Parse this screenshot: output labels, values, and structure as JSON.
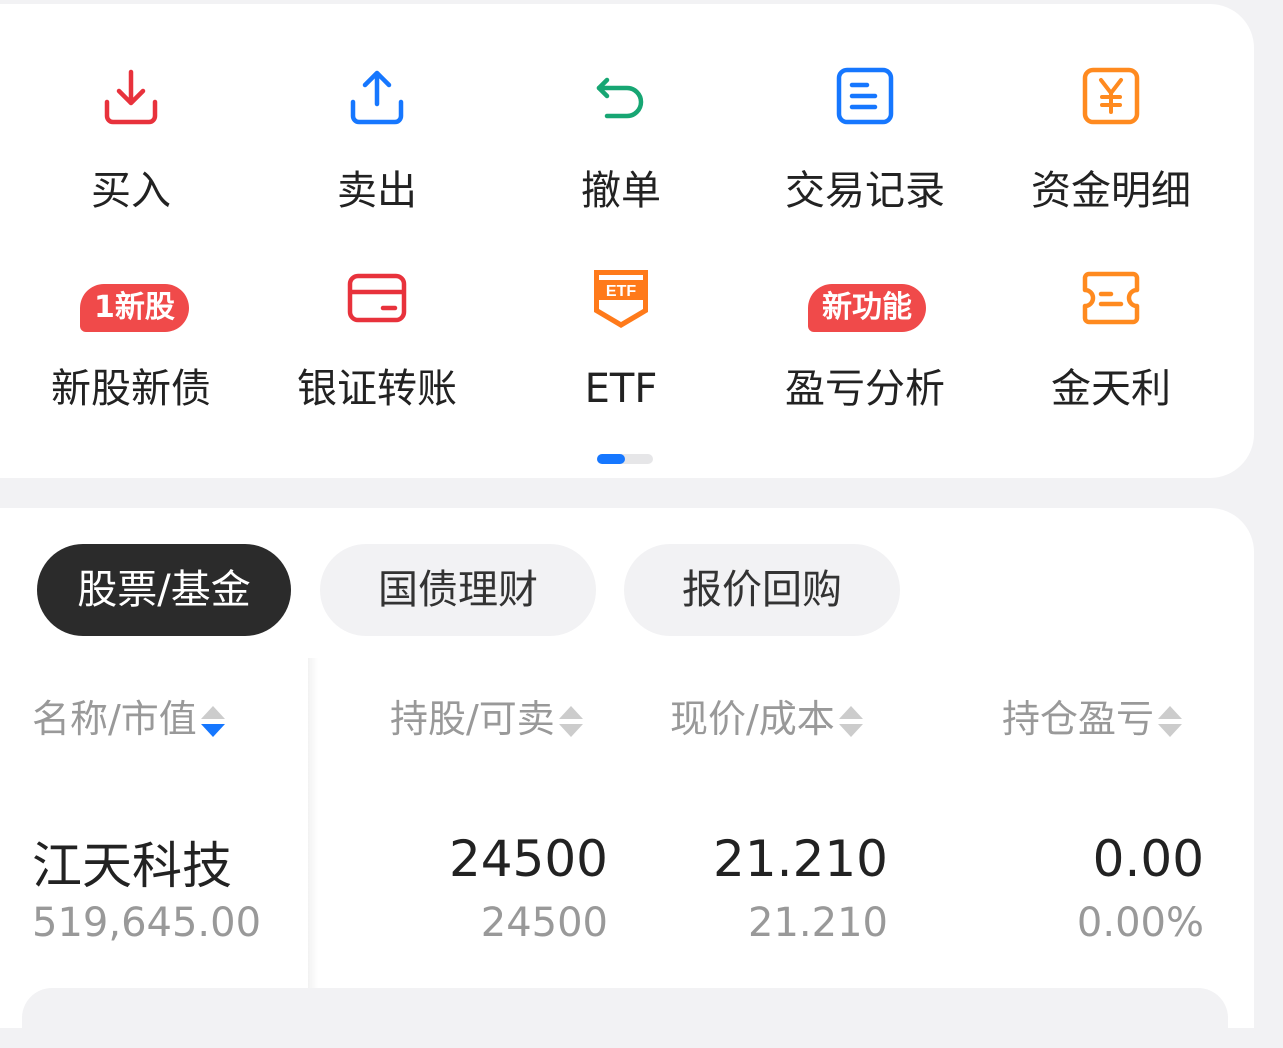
{
  "functions": {
    "row1": [
      {
        "label": "买入",
        "icon": "download-icon",
        "color": "#e8323c"
      },
      {
        "label": "卖出",
        "icon": "upload-icon",
        "color": "#1677ff"
      },
      {
        "label": "撤单",
        "icon": "undo-icon",
        "color": "#17a673"
      },
      {
        "label": "交易记录",
        "icon": "document-list-icon",
        "color": "#1677ff"
      },
      {
        "label": "资金明细",
        "icon": "yuan-icon",
        "color": "#ff8a1f"
      }
    ],
    "row2": [
      {
        "label": "新股新债",
        "icon": "new-stock-icon",
        "badge": "1新股"
      },
      {
        "label": "银证转账",
        "icon": "bank-card-icon",
        "color": "#e8323c"
      },
      {
        "label": "ETF",
        "icon": "etf-shield-icon",
        "color": "#ff7a1a"
      },
      {
        "label": "盈亏分析",
        "icon": "profit-analysis-icon",
        "badge": "新功能"
      },
      {
        "label": "金天利",
        "icon": "ticket-icon",
        "color": "#ff8a1f"
      }
    ]
  },
  "tabs": [
    "股票/基金",
    "国债理财",
    "报价回购"
  ],
  "table": {
    "headers": [
      "名称/市值",
      "持股/可卖",
      "现价/成本",
      "持仓盈亏"
    ],
    "rows": [
      {
        "name": "江天科技",
        "market_value": "519,645.00",
        "shares": "24500",
        "available": "24500",
        "price": "21.210",
        "cost": "21.210",
        "pnl": "0.00",
        "pnl_pct": "0.00%"
      }
    ]
  }
}
